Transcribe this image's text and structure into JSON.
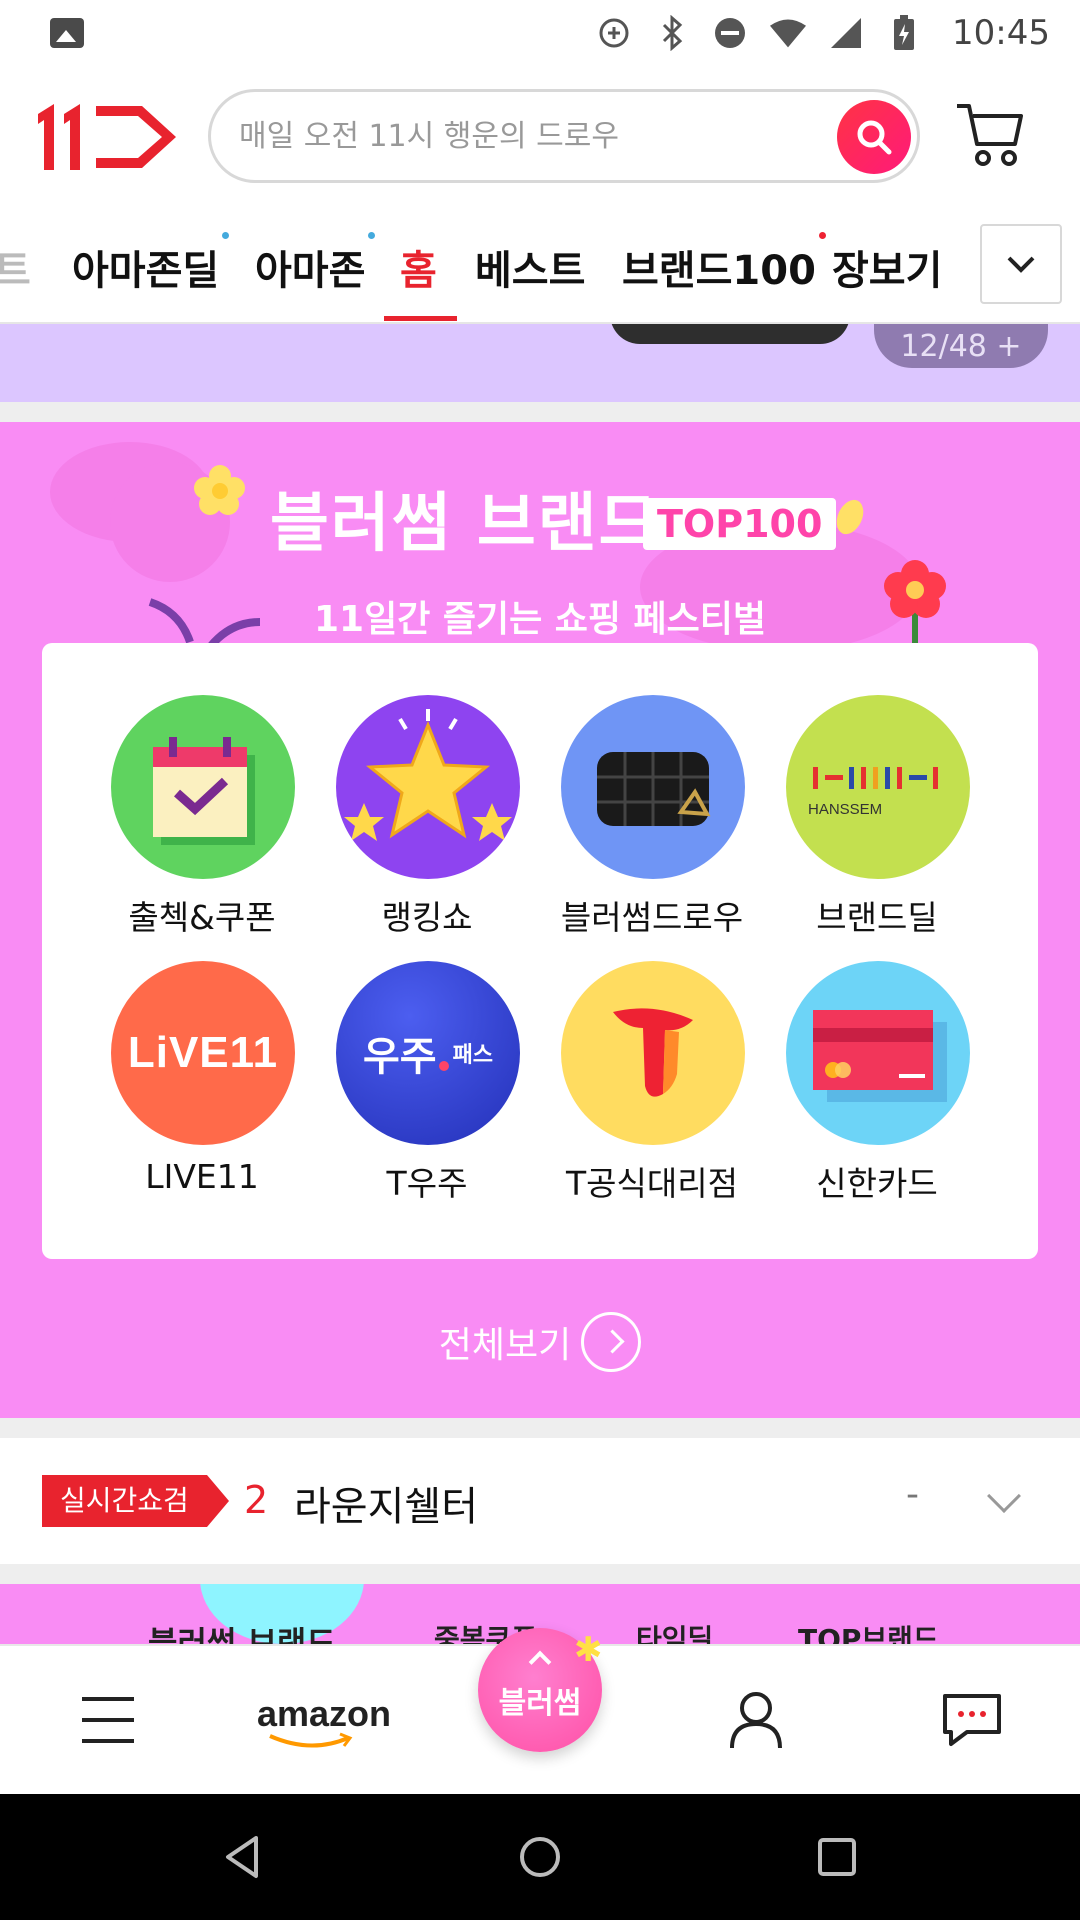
{
  "status_bar": {
    "time": "10:45",
    "icons": [
      "image-icon",
      "data-saver-icon",
      "bluetooth-icon",
      "do-not-disturb-icon",
      "wifi-icon",
      "signal-icon",
      "battery-charging-icon"
    ]
  },
  "header": {
    "logo": "11st-logo",
    "search_placeholder": "매일 오전 11시 행운의 드로우",
    "search_icon": "search-icon",
    "cart_icon": "cart-icon",
    "accent_color": "#e8232e"
  },
  "tabs": {
    "items": [
      {
        "label": "트",
        "faded": true
      },
      {
        "label": "아마존딜",
        "dot": true
      },
      {
        "label": "아마존",
        "dot": true
      },
      {
        "label": "홈",
        "active": true
      },
      {
        "label": "베스트"
      },
      {
        "label": "브랜드100",
        "dot": true
      },
      {
        "label": "장보기"
      }
    ],
    "more_icon": "chevron-down-icon"
  },
  "top_banner": {
    "counter": "12/48 +"
  },
  "festival": {
    "title": "블러썸 브랜드",
    "badge": "TOP100",
    "subtitle": "11일간 즐기는 쇼핑 페스티벌",
    "background": "#f98cf4",
    "menu": [
      {
        "label": "출첵&쿠폰",
        "icon": "calendar-check-icon"
      },
      {
        "label": "랭킹쇼",
        "icon": "star-icon"
      },
      {
        "label": "블러썸드로우",
        "icon": "handbag-icon"
      },
      {
        "label": "브랜드딜",
        "icon": "hanssem-logo-icon",
        "brand_text": "HANSSEM"
      },
      {
        "label": "LIVE11",
        "icon": "live11-icon",
        "icon_text": "LiVE11"
      },
      {
        "label": "T우주",
        "icon": "woojoo-pass-icon",
        "icon_text": "우주",
        "icon_sub": "패스"
      },
      {
        "label": "T공식대리점",
        "icon": "t-logo-icon"
      },
      {
        "label": "신한카드",
        "icon": "credit-card-icon"
      }
    ],
    "view_all": "전체보기"
  },
  "realtime": {
    "badge": "실시간쇼검",
    "rank": "2",
    "term": "라운지쉘터",
    "change": "-"
  },
  "next_banner": {
    "items": [
      "블러썸 브랜드",
      "중복쿠폰",
      "타임딜",
      "TOP브랜드"
    ]
  },
  "bottom_nav": {
    "menu_icon": "menu-icon",
    "amazon_label": "amazon",
    "fab_label": "블러썸",
    "profile_icon": "person-icon",
    "chat_icon": "chat-icon"
  }
}
